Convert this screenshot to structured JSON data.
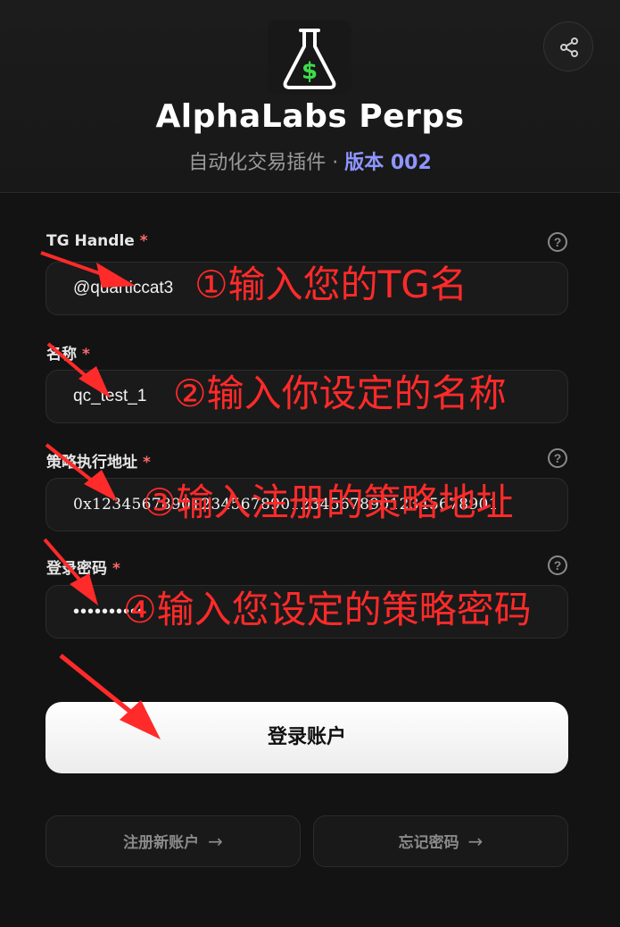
{
  "header": {
    "title": "AlphaLabs Perps",
    "subtitle_prefix": "自动化交易插件 · ",
    "version": "版本 002"
  },
  "fields": [
    {
      "label": "TG Handle",
      "required": "*",
      "value": "@quarticcat3",
      "annotation": "①输入您的TG名"
    },
    {
      "label": "名称",
      "required": "*",
      "value": "qc_test_1",
      "annotation": "②输入你设定的名称"
    },
    {
      "label": "策略执行地址",
      "required": "*",
      "value": "0x12345678901234567890123456789012345678901",
      "annotation": "③输入注册的策略地址"
    },
    {
      "label": "登录密码",
      "required": "*",
      "value": "••••••••••",
      "annotation": "④输入您设定的策略密码"
    }
  ],
  "help_glyph": "?",
  "buttons": {
    "login": "登录账户",
    "register": "注册新账户",
    "forgot": "忘记密码",
    "arrow": "→"
  },
  "colors": {
    "background": "#131313",
    "accent_version": "#8f95ff",
    "annotation": "#ff2a2a",
    "required": "#ff6b6b"
  },
  "icons": {
    "logo": "flask-dollar-icon",
    "share": "share-icon",
    "help": "help-circle-icon"
  }
}
